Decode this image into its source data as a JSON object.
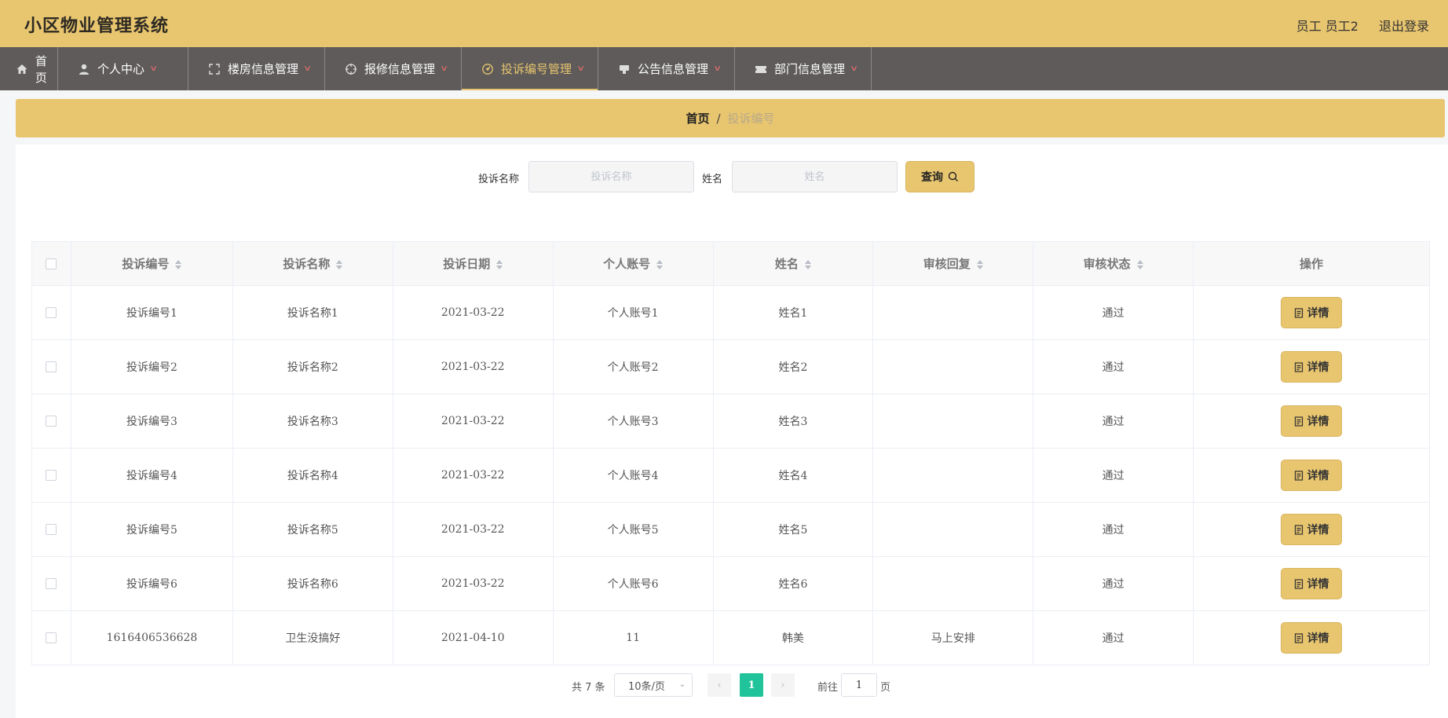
{
  "header": {
    "title": "小区物业管理系统",
    "user": "员工 员工2",
    "logout": "退出登录"
  },
  "nav": [
    {
      "label": "首页",
      "icon": "home-icon",
      "has_arrow": false
    },
    {
      "label": "个人中心",
      "icon": "user-icon",
      "has_arrow": true
    },
    {
      "label": "楼房信息管理",
      "icon": "fullscreen-icon",
      "has_arrow": true
    },
    {
      "label": "报修信息管理",
      "icon": "aim-icon",
      "has_arrow": true
    },
    {
      "label": "投诉编号管理",
      "icon": "speedometer-icon",
      "has_arrow": true,
      "active": true
    },
    {
      "label": "公告信息管理",
      "icon": "speaker-icon",
      "has_arrow": true
    },
    {
      "label": "部门信息管理",
      "icon": "ticket-icon",
      "has_arrow": true
    }
  ],
  "breadcrumb": {
    "home": "首页",
    "separator": "/",
    "current": "投诉编号"
  },
  "search": {
    "name_label": "投诉名称",
    "name_placeholder": "投诉名称",
    "person_label": "姓名",
    "person_placeholder": "姓名",
    "button": "查询"
  },
  "table": {
    "columns": [
      "投诉编号",
      "投诉名称",
      "投诉日期",
      "个人账号",
      "姓名",
      "审核回复",
      "审核状态",
      "操作"
    ],
    "rows": [
      [
        "投诉编号1",
        "投诉名称1",
        "2021-03-22",
        "个人账号1",
        "姓名1",
        "",
        "通过"
      ],
      [
        "投诉编号2",
        "投诉名称2",
        "2021-03-22",
        "个人账号2",
        "姓名2",
        "",
        "通过"
      ],
      [
        "投诉编号3",
        "投诉名称3",
        "2021-03-22",
        "个人账号3",
        "姓名3",
        "",
        "通过"
      ],
      [
        "投诉编号4",
        "投诉名称4",
        "2021-03-22",
        "个人账号4",
        "姓名4",
        "",
        "通过"
      ],
      [
        "投诉编号5",
        "投诉名称5",
        "2021-03-22",
        "个人账号5",
        "姓名5",
        "",
        "通过"
      ],
      [
        "投诉编号6",
        "投诉名称6",
        "2021-03-22",
        "个人账号6",
        "姓名6",
        "",
        "通过"
      ],
      [
        "1616406536628",
        "卫生没搞好",
        "2021-04-10",
        "11",
        "韩美",
        "马上安排",
        "通过"
      ]
    ],
    "action_label": "详情"
  },
  "pagination": {
    "total": "共 7 条",
    "page_size": "10条/页",
    "current_page": "1",
    "goto_label": "前往",
    "goto_value": "1",
    "goto_unit": "页"
  },
  "colors": {
    "accent": "#e8c56f",
    "nav_bg": "#5e5b5a",
    "page_active": "#21c49a"
  }
}
